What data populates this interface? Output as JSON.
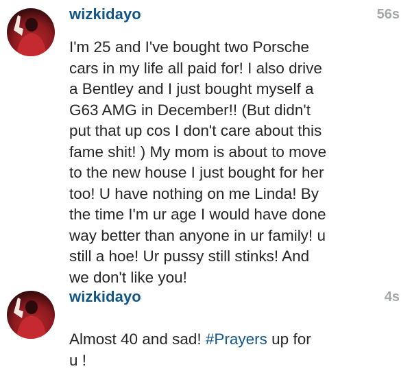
{
  "comments": [
    {
      "username": "wizkidayo",
      "timestamp": "56s",
      "lines": [
        "I'm 25 and I've bought two Porsche",
        "cars in my life all paid for! I also drive",
        "a Bentley and I just bought myself a",
        "G63 AMG in December!! (But didn't",
        "put that up cos I don't care about this",
        "fame shit! ) My mom is about to move",
        "to the new house I just bought for her",
        "too! U have nothing on me Linda! By",
        "the time I'm ur age I would have done",
        "way better than anyone in ur family! u",
        "still a hoe! Ur pussy still stinks! And",
        "we don't like you!"
      ]
    },
    {
      "username": "wizkidayo",
      "timestamp": "4s",
      "text_before": "Almost 40 and sad! ",
      "hashtag": "#Prayers",
      "text_after": " up for",
      "line2": "u !"
    }
  ],
  "colors": {
    "username": "#125688",
    "hashtag": "#125688",
    "timestamp": "#a5a7aa",
    "text": "#262626"
  },
  "icons": {
    "avatar": "profile-photo"
  }
}
